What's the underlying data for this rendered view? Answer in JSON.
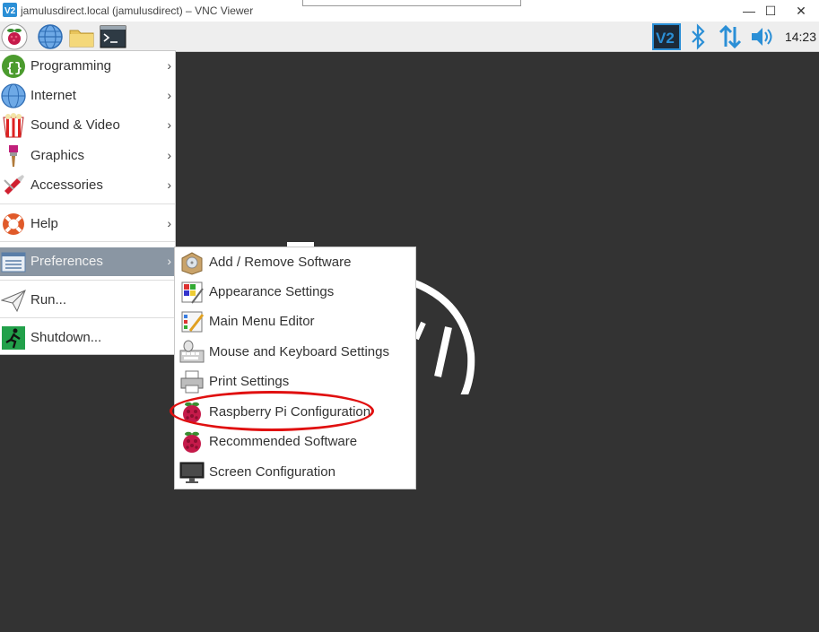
{
  "window": {
    "title": "jamulusdirect.local (jamulusdirect) – VNC Viewer",
    "controls": {
      "minimize": "—",
      "maximize": "☐",
      "close": "✕"
    }
  },
  "taskbar": {
    "left_icons": [
      "raspberry-menu-icon",
      "web-browser-icon",
      "file-manager-icon",
      "terminal-icon"
    ],
    "tray_icons": [
      "vnc-server-icon",
      "bluetooth-icon",
      "network-icon",
      "volume-icon"
    ],
    "clock": "14:23",
    "colors": {
      "accent": "#4a90d9",
      "raspberry": "#c51a4a",
      "leaf": "#3a8c2f"
    }
  },
  "main_menu": {
    "items": [
      {
        "label": "Programming",
        "icon": "programming-icon",
        "has_submenu": true
      },
      {
        "label": "Internet",
        "icon": "internet-globe-icon",
        "has_submenu": true
      },
      {
        "label": "Sound & Video",
        "icon": "sound-video-icon",
        "has_submenu": true
      },
      {
        "label": "Graphics",
        "icon": "graphics-brush-icon",
        "has_submenu": true
      },
      {
        "label": "Accessories",
        "icon": "accessories-knife-icon",
        "has_submenu": true
      },
      {
        "label": "Help",
        "icon": "help-lifebuoy-icon",
        "has_submenu": true
      },
      {
        "label": "Preferences",
        "icon": "preferences-icon",
        "has_submenu": true,
        "active": true
      },
      {
        "label": "Run...",
        "icon": "run-paper-plane-icon",
        "has_submenu": false
      },
      {
        "label": "Shutdown...",
        "icon": "shutdown-exit-icon",
        "has_submenu": false
      }
    ],
    "arrow": "›",
    "active_color": "#8a96a3"
  },
  "preferences_menu": {
    "items": [
      {
        "label": "Add / Remove Software",
        "icon": "package-box-icon"
      },
      {
        "label": "Appearance Settings",
        "icon": "appearance-palette-icon"
      },
      {
        "label": "Main Menu Editor",
        "icon": "menu-editor-icon"
      },
      {
        "label": "Mouse and Keyboard Settings",
        "icon": "mouse-keyboard-icon"
      },
      {
        "label": "Print Settings",
        "icon": "printer-icon"
      },
      {
        "label": "Raspberry Pi Configuration",
        "icon": "raspberry-pi-config-icon",
        "highlighted": true
      },
      {
        "label": "Recommended Software",
        "icon": "raspberry-recommended-icon"
      },
      {
        "label": "Screen Configuration",
        "icon": "monitor-icon"
      }
    ],
    "highlight_color": "#e01010"
  }
}
